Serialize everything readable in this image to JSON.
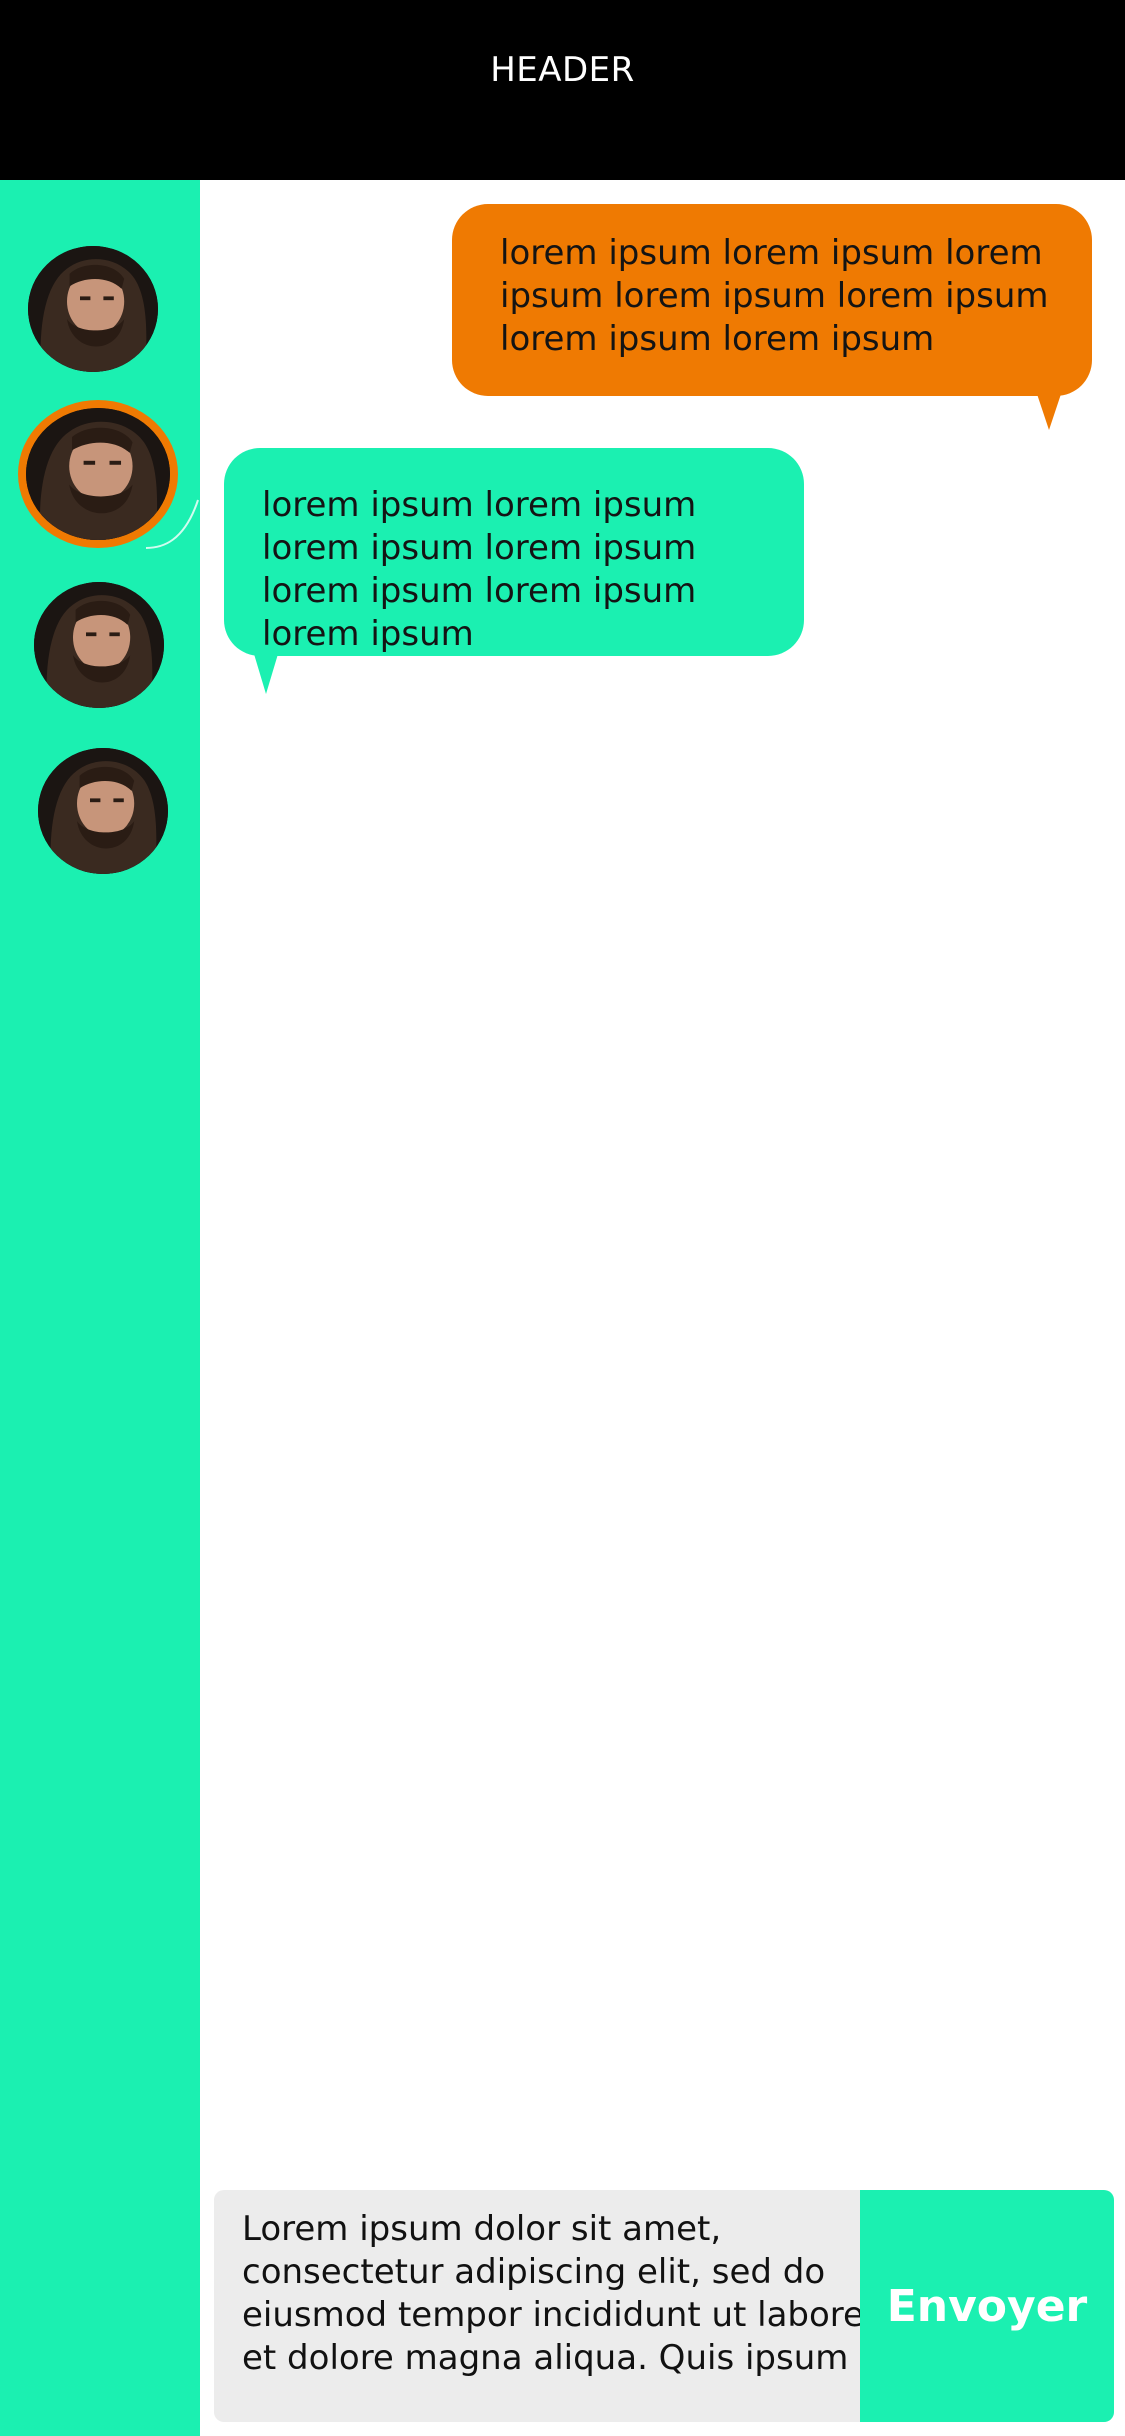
{
  "header": {
    "title": "HEADER"
  },
  "sidebar": {
    "contacts": [
      {
        "name": "contact-1",
        "active": false,
        "icon": "avatar-photo"
      },
      {
        "name": "contact-2",
        "active": true,
        "icon": "avatar-photo"
      },
      {
        "name": "contact-3",
        "active": false,
        "icon": "avatar-photo"
      },
      {
        "name": "contact-4",
        "active": false,
        "icon": "avatar-photo"
      }
    ]
  },
  "messages": [
    {
      "direction": "outgoing",
      "text": "lorem ipsum lorem ipsum lorem ipsum lorem ipsum lorem ipsum lorem ipsum lorem ipsum"
    },
    {
      "direction": "incoming",
      "text": "lorem ipsum lorem ipsum lorem ipsum lorem ipsum lorem ipsum lorem ipsum lorem ipsum"
    }
  ],
  "composer": {
    "value": "Lorem ipsum dolor sit amet, consectetur adipiscing elit, sed do eiusmod tempor incididunt ut labore et dolore magna aliqua. Quis ipsum",
    "send_label": "Envoyer"
  },
  "colors": {
    "header_bg": "#000000",
    "accent_green": "#1bf0b1",
    "accent_orange": "#ef7a02",
    "input_bg": "#ececec"
  }
}
